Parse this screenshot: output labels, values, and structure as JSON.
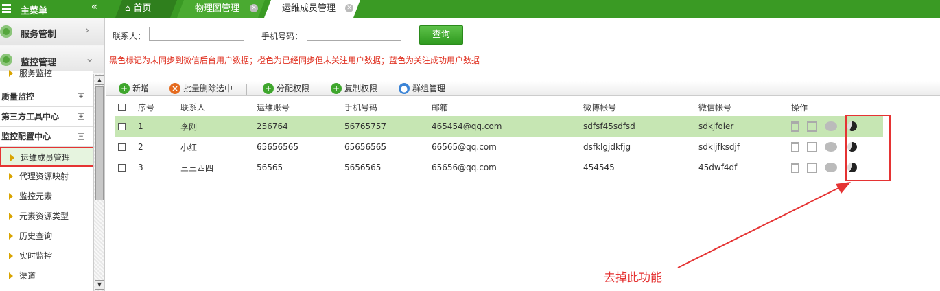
{
  "header": {
    "menu_title": "主菜单",
    "collapse_glyph": "«",
    "tabs": [
      {
        "label": "首页",
        "icon": "home-icon"
      },
      {
        "label": "物理图管理",
        "closable": true
      },
      {
        "label": "运维成员管理",
        "closable": true
      }
    ]
  },
  "sidebar": {
    "sections": [
      {
        "label": "服务管制",
        "icon": "gear-icon",
        "arrow": "›"
      },
      {
        "label": "监控管理",
        "icon": "gear-icon",
        "arrow": "⌄"
      }
    ],
    "partial_item": "服务监控",
    "groups": [
      {
        "label": "质量监控",
        "toggle": "+"
      },
      {
        "label": "第三方工具中心",
        "toggle": "+"
      },
      {
        "label": "监控配置中心",
        "toggle": "−"
      }
    ],
    "items": [
      "运维成员管理",
      "代理资源映射",
      "监控元素",
      "元素资源类型",
      "历史查询",
      "实时监控",
      "渠道"
    ],
    "active_item": "运维成员管理"
  },
  "search": {
    "contact_label": "联系人：",
    "contact_value": "",
    "phone_label": "手机号码：",
    "phone_value": "",
    "query_button": "查询"
  },
  "notice": "黑色标记为未同步到微信后台用户数据；橙色为已经同步但未关注用户数据；蓝色为关注成功用户数据",
  "toolbar": [
    {
      "label": "新增",
      "icon": "add-icon",
      "color": "#3fa62d"
    },
    {
      "label": "批量删除选中",
      "icon": "delete-icon",
      "color": "#e56b1f"
    },
    {
      "label": "分配权限",
      "icon": "add-icon",
      "color": "#3fa62d"
    },
    {
      "label": "复制权限",
      "icon": "add-icon",
      "color": "#3fa62d"
    },
    {
      "label": "群组管理",
      "icon": "group-icon",
      "color": "#3b84d6"
    }
  ],
  "table": {
    "columns": [
      "序号",
      "联系人",
      "运维账号",
      "手机号码",
      "邮箱",
      "微博帐号",
      "微信帐号",
      "操作"
    ],
    "rows": [
      {
        "no": "1",
        "contact": "李刚",
        "account": "256764",
        "phone": "56765757",
        "email": "465454@qq.com",
        "weibo": "sdfsf45sdfsd",
        "wechat": "sdkjfoier",
        "selected": true
      },
      {
        "no": "2",
        "contact": "小红",
        "account": "65656565",
        "phone": "65656565",
        "email": "66565@qq.com",
        "weibo": "dsfklgjdkfjg",
        "wechat": "sdkljfksdjf",
        "selected": false
      },
      {
        "no": "3",
        "contact": "三三四四",
        "account": "56565",
        "phone": "5656565",
        "email": "65656@qq.com",
        "weibo": "454545",
        "wechat": "45dwf4df",
        "selected": false
      }
    ],
    "row_actions": [
      "trash-icon",
      "edit-icon",
      "wechat-icon",
      "pie-chart-icon"
    ]
  },
  "annotation": {
    "text": "去掉此功能",
    "color": "#e53333"
  },
  "colors": {
    "brand_green": "#3a9a24",
    "selected_row": "#c6e6b3",
    "annotation_red": "#e53333"
  }
}
